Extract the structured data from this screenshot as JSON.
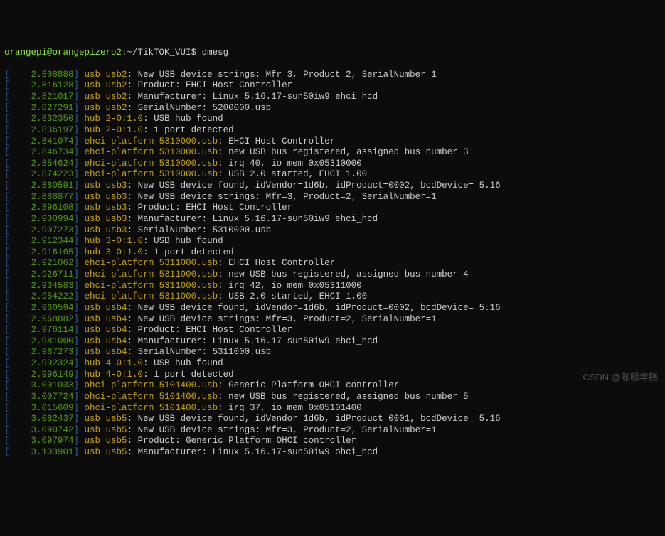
{
  "prompt": {
    "user": "orangepi@orangepizero2",
    "path": "~/TikTOK_VUI",
    "cmd": "dmesg"
  },
  "watermark": "CSDN @咖喱年糕",
  "lines": [
    {
      "ts": "2.808888",
      "dev": "usb usb2",
      "msg": "New USB device strings: Mfr=3, Product=2, SerialNumber=1"
    },
    {
      "ts": "2.816128",
      "dev": "usb usb2",
      "msg": "Product: EHCI Host Controller"
    },
    {
      "ts": "2.821017",
      "dev": "usb usb2",
      "msg": "Manufacturer: Linux 5.16.17-sun50iw9 ehci_hcd"
    },
    {
      "ts": "2.827291",
      "dev": "usb usb2",
      "msg": "SerialNumber: 5200000.usb"
    },
    {
      "ts": "2.832350",
      "dev": "hub 2-0:1.0",
      "msg": "USB hub found"
    },
    {
      "ts": "2.836197",
      "dev": "hub 2-0:1.0",
      "msg": "1 port detected"
    },
    {
      "ts": "2.841074",
      "dev": "ehci-platform 5310000.usb",
      "msg": "EHCI Host Controller"
    },
    {
      "ts": "2.846734",
      "dev": "ehci-platform 5310000.usb",
      "msg": "new USB bus registered, assigned bus number 3"
    },
    {
      "ts": "2.854624",
      "dev": "ehci-platform 5310000.usb",
      "msg": "irq 40, io mem 0x05310000"
    },
    {
      "ts": "2.874223",
      "dev": "ehci-platform 5310000.usb",
      "msg": "USB 2.0 started, EHCI 1.00"
    },
    {
      "ts": "2.880591",
      "dev": "usb usb3",
      "msg": "New USB device found, idVendor=1d6b, idProduct=0002, bcdDevice= 5.16"
    },
    {
      "ts": "2.888877",
      "dev": "usb usb3",
      "msg": "New USB device strings: Mfr=3, Product=2, SerialNumber=1"
    },
    {
      "ts": "2.896108",
      "dev": "usb usb3",
      "msg": "Product: EHCI Host Controller"
    },
    {
      "ts": "2.900994",
      "dev": "usb usb3",
      "msg": "Manufacturer: Linux 5.16.17-sun50iw9 ehci_hcd"
    },
    {
      "ts": "2.907273",
      "dev": "usb usb3",
      "msg": "SerialNumber: 5310000.usb"
    },
    {
      "ts": "2.912344",
      "dev": "hub 3-0:1.0",
      "msg": "USB hub found"
    },
    {
      "ts": "2.916165",
      "dev": "hub 3-0:1.0",
      "msg": "1 port detected"
    },
    {
      "ts": "2.921062",
      "dev": "ehci-platform 5311000.usb",
      "msg": "EHCI Host Controller"
    },
    {
      "ts": "2.926711",
      "dev": "ehci-platform 5311000.usb",
      "msg": "new USB bus registered, assigned bus number 4"
    },
    {
      "ts": "2.934583",
      "dev": "ehci-platform 5311000.usb",
      "msg": "irq 42, io mem 0x05311000"
    },
    {
      "ts": "2.954222",
      "dev": "ehci-platform 5311000.usb",
      "msg": "USB 2.0 started, EHCI 1.00"
    },
    {
      "ts": "2.960594",
      "dev": "usb usb4",
      "msg": "New USB device found, idVendor=1d6b, idProduct=0002, bcdDevice= 5.16"
    },
    {
      "ts": "2.968882",
      "dev": "usb usb4",
      "msg": "New USB device strings: Mfr=3, Product=2, SerialNumber=1"
    },
    {
      "ts": "2.976114",
      "dev": "usb usb4",
      "msg": "Product: EHCI Host Controller"
    },
    {
      "ts": "2.981000",
      "dev": "usb usb4",
      "msg": "Manufacturer: Linux 5.16.17-sun50iw9 ehci_hcd"
    },
    {
      "ts": "2.987273",
      "dev": "usb usb4",
      "msg": "SerialNumber: 5311000.usb"
    },
    {
      "ts": "2.992324",
      "dev": "hub 4-0:1.0",
      "msg": "USB hub found"
    },
    {
      "ts": "2.996149",
      "dev": "hub 4-0:1.0",
      "msg": "1 port detected"
    },
    {
      "ts": "3.001033",
      "dev": "ohci-platform 5101400.usb",
      "msg": "Generic Platform OHCI controller"
    },
    {
      "ts": "3.007724",
      "dev": "ohci-platform 5101400.usb",
      "msg": "new USB bus registered, assigned bus number 5"
    },
    {
      "ts": "3.015609",
      "dev": "ohci-platform 5101400.usb",
      "msg": "irq 37, io mem 0x05101400"
    },
    {
      "ts": "3.082437",
      "dev": "usb usb5",
      "msg": "New USB device found, idVendor=1d6b, idProduct=0001, bcdDevice= 5.16"
    },
    {
      "ts": "3.090742",
      "dev": "usb usb5",
      "msg": "New USB device strings: Mfr=3, Product=2, SerialNumber=1"
    },
    {
      "ts": "3.097974",
      "dev": "usb usb5",
      "msg": "Product: Generic Platform OHCI controller"
    },
    {
      "ts": "3.103901",
      "dev": "usb usb5",
      "msg": "Manufacturer: Linux 5.16.17-sun50iw9 ohci_hcd"
    }
  ]
}
